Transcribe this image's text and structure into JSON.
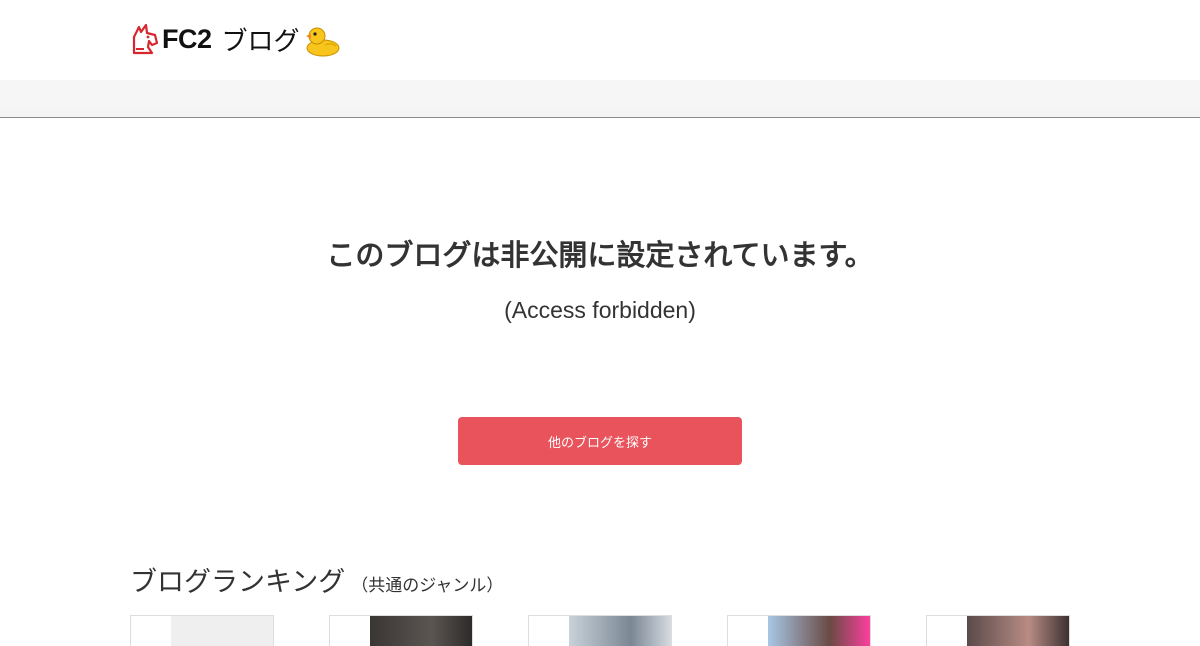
{
  "header": {
    "logo_text": "FC2",
    "logo_blog": "ブログ",
    "colors": {
      "mark": "#d7262e",
      "duck": "#f7c51c",
      "beak": "#f08a1c"
    },
    "icons": [
      "fc2-unicorn-icon",
      "duck-icon"
    ]
  },
  "main": {
    "heading": "このブログは非公開に設定されています。",
    "subheading": "(Access forbidden)",
    "cta_label": "他のブログを探す",
    "cta_color": "#e9535c"
  },
  "ranking": {
    "title": "ブログランキング",
    "subtitle": "（共通のジャンル）",
    "cards": [
      {
        "thumb_color": "#efefef"
      },
      {
        "thumb_color": "#3a3634"
      },
      {
        "thumb_color": "#c9d2d9"
      },
      {
        "thumb_color": "#a8c7e6"
      },
      {
        "thumb_color": "#5a4a4a"
      }
    ]
  }
}
